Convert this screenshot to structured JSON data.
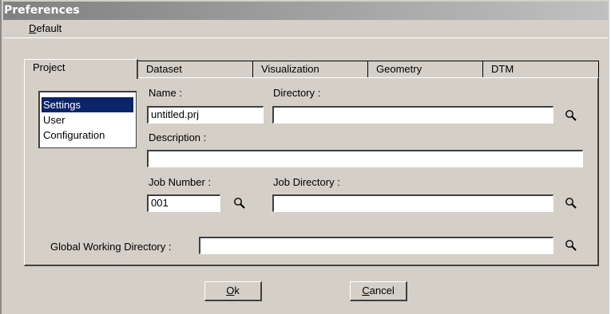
{
  "window": {
    "title": "Preferences"
  },
  "menu": {
    "default_label": "Default"
  },
  "tabs": [
    {
      "label": "Project"
    },
    {
      "label": "Dataset"
    },
    {
      "label": "Visualization"
    },
    {
      "label": "Geometry"
    },
    {
      "label": "DTM"
    }
  ],
  "categories": [
    {
      "label": "Settings",
      "selected": true
    },
    {
      "label": "User",
      "selected": false
    },
    {
      "label": "Configuration",
      "selected": false
    }
  ],
  "form": {
    "name_label": "Name :",
    "name_value": "untitled.prj",
    "directory_label": "Directory :",
    "directory_value": "",
    "description_label": "Description :",
    "description_value": "",
    "job_number_label": "Job Number :",
    "job_number_value": "001",
    "job_directory_label": "Job Directory :",
    "job_directory_value": "",
    "global_dir_label": "Global Working Directory :",
    "global_dir_value": ""
  },
  "buttons": {
    "ok": "Ok",
    "cancel": "Cancel"
  },
  "icons": {
    "browse": "magnifier-icon"
  },
  "colors": {
    "selection": "#0a246a",
    "face": "#d4d0c8"
  }
}
